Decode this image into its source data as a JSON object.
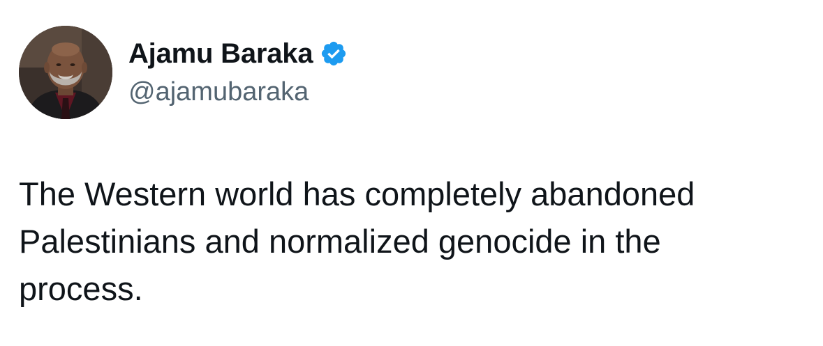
{
  "author": {
    "display_name": "Ajamu Baraka",
    "handle": "@ajamubaraka",
    "verified": true,
    "verified_icon": "verified-badge-icon",
    "verified_color": "#1d9bf0",
    "avatar_icon": "profile-photo"
  },
  "tweet": {
    "text": "The Western world has completely abandoned\nPalestinians and normalized genocide in the\nprocess."
  },
  "colors": {
    "text_primary": "#0f1419",
    "text_secondary": "#536471",
    "background": "#ffffff"
  }
}
